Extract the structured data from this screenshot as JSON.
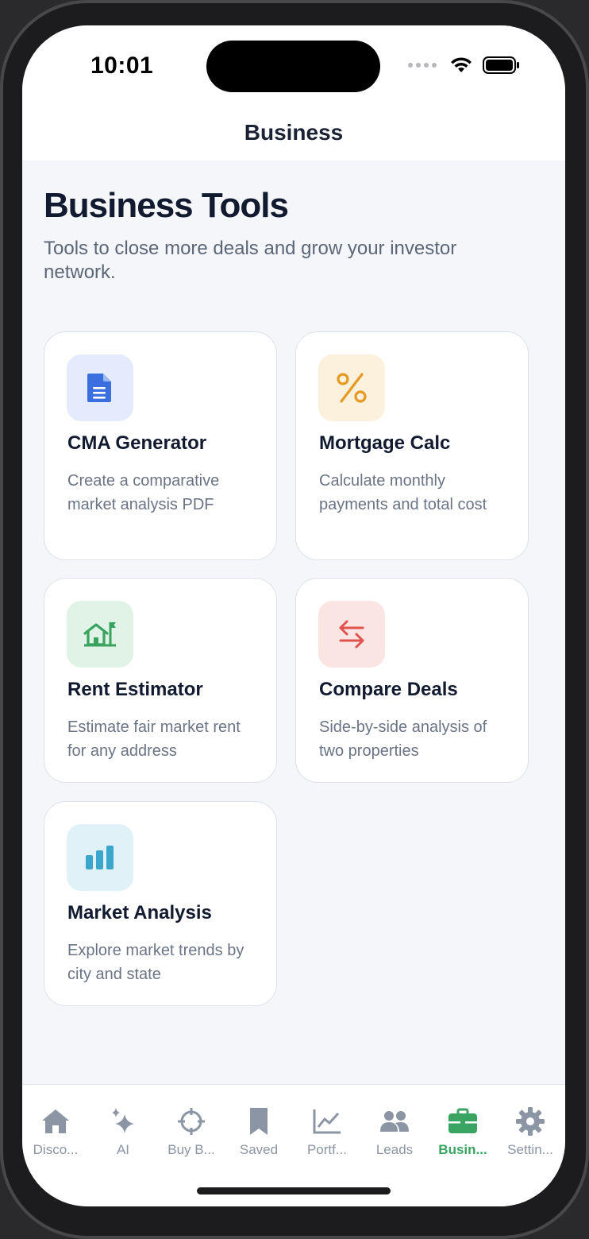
{
  "status_bar": {
    "time": "10:01"
  },
  "nav": {
    "title": "Business"
  },
  "header": {
    "title": "Business Tools",
    "subtitle": "Tools to close more deals and grow your investor network."
  },
  "tools": [
    {
      "title": "CMA Generator",
      "description": "Create a comparative market analysis PDF",
      "icon": "document-icon",
      "icon_color": "#3b6fe0",
      "icon_bg": "#e4ebfc"
    },
    {
      "title": "Mortgage Calc",
      "description": "Calculate monthly payments and total cost",
      "icon": "percent-icon",
      "icon_color": "#e79a22",
      "icon_bg": "#fcf1dc"
    },
    {
      "title": "Rent Estimator",
      "description": "Estimate fair market rent for any address",
      "icon": "house-flag-icon",
      "icon_color": "#37a35f",
      "icon_bg": "#e1f3e6"
    },
    {
      "title": "Compare Deals",
      "description": "Side-by-side analysis of two properties",
      "icon": "swap-arrows-icon",
      "icon_color": "#e0524b",
      "icon_bg": "#fbe5e3"
    },
    {
      "title": "Market Analysis",
      "description": "Explore market trends by city and state",
      "icon": "bar-chart-icon",
      "icon_color": "#3aa6cc",
      "icon_bg": "#e0f2f8"
    }
  ],
  "tab_bar": {
    "active_color": "#3aa562",
    "inactive_color": "#8b95a3",
    "tabs": [
      {
        "label": "Disco...",
        "icon": "home-icon"
      },
      {
        "label": "AI",
        "icon": "sparkle-icon"
      },
      {
        "label": "Buy B...",
        "icon": "crosshair-icon"
      },
      {
        "label": "Saved",
        "icon": "bookmark-icon"
      },
      {
        "label": "Portf...",
        "icon": "chart-line-icon"
      },
      {
        "label": "Leads",
        "icon": "people-icon"
      },
      {
        "label": "Busin...",
        "icon": "briefcase-icon",
        "active": true
      },
      {
        "label": "Settin...",
        "icon": "gear-icon"
      }
    ]
  }
}
